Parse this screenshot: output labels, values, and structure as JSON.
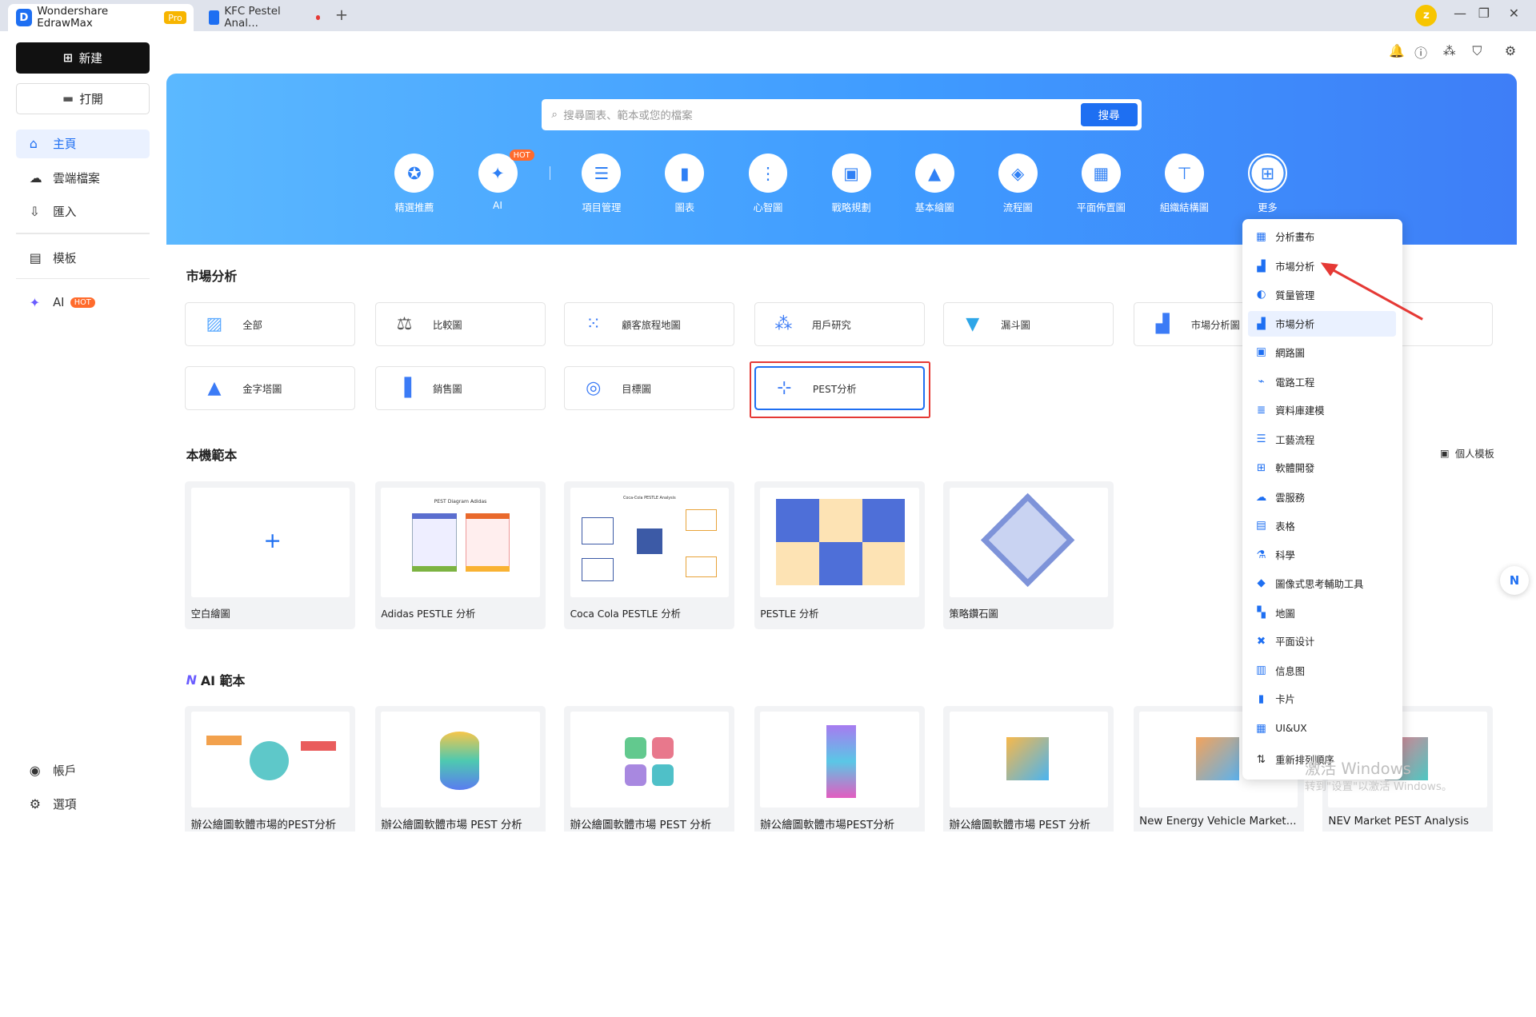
{
  "titlebar": {
    "app_title": "Wondershare EdrawMax",
    "pro_badge": "Pro",
    "doc_tab": "KFC Pestel Anal...",
    "avatar_letter": "z"
  },
  "sidebar": {
    "new_label": "新建",
    "open_label": "打開",
    "items": [
      {
        "label": "主頁",
        "icon": "home-icon"
      },
      {
        "label": "雲端檔案",
        "icon": "cloud-icon"
      },
      {
        "label": "匯入",
        "icon": "import-icon"
      },
      {
        "label": "模板",
        "icon": "template-icon"
      },
      {
        "label": "AI",
        "icon": "sparkle-icon",
        "badge": "HOT"
      }
    ],
    "bottom": [
      {
        "label": "帳戶",
        "icon": "account-icon"
      },
      {
        "label": "選項",
        "icon": "settings-icon"
      }
    ]
  },
  "search": {
    "placeholder": "搜尋圖表、範本或您的檔案",
    "button": "搜尋"
  },
  "categories": [
    {
      "label": "精選推薦",
      "icon": "recommend-icon"
    },
    {
      "label": "AI",
      "icon": "ai-icon",
      "badge": "HOT"
    },
    {
      "label": "項目管理",
      "icon": "project-icon"
    },
    {
      "label": "圖表",
      "icon": "chart-icon"
    },
    {
      "label": "心智圖",
      "icon": "mindmap-icon"
    },
    {
      "label": "戰略規劃",
      "icon": "strategy-icon"
    },
    {
      "label": "基本繪圖",
      "icon": "basic-icon"
    },
    {
      "label": "流程圖",
      "icon": "flowchart-icon"
    },
    {
      "label": "平面佈置圖",
      "icon": "floorplan-icon"
    },
    {
      "label": "組織結構圖",
      "icon": "org-icon"
    },
    {
      "label": "更多",
      "icon": "more-icon"
    }
  ],
  "market_section": {
    "title": "市場分析",
    "chips": [
      "全部",
      "比較圖",
      "顧客旅程地圖",
      "用戶研究",
      "漏斗圖",
      "市場分析圖",
      "金字塔圖",
      "銷售圖",
      "目標圖",
      "PEST分析"
    ]
  },
  "local_templates": {
    "title": "本機範本",
    "personal_label": "個人模板",
    "cards": [
      "空白繪圖",
      "Adidas PESTLE 分析",
      "Coca Cola PESTLE 分析",
      "PESTLE 分析",
      "策略鑽石圖"
    ],
    "adidas_thumb_title": "PEST Diagram Adidas",
    "coca_thumb_title": "Coca-Cola PESTLE Analysis"
  },
  "ai_templates": {
    "title": "AI 範本",
    "cards": [
      "辦公繪圖軟體市場的PEST分析",
      "辦公繪圖軟體市場 PEST 分析",
      "辦公繪圖軟體市場 PEST 分析",
      "辦公繪圖軟體市場PEST分析",
      "辦公繪圖軟體市場 PEST 分析",
      "New Energy Vehicle Market...",
      "NEV Market PEST Analysis"
    ]
  },
  "dropdown": {
    "items": [
      "分析畫布",
      "市場分析",
      "質量管理",
      "市場分析",
      "網路圖",
      "電路工程",
      "資料庫建模",
      "工藝流程",
      "軟體開發",
      "雲服務",
      "表格",
      "科學",
      "圖像式思考輔助工具",
      "地圖",
      "平面设计",
      "信息图",
      "卡片",
      "UI&UX",
      "重新排列順序"
    ]
  },
  "watermark": {
    "line1": "激活 Windows",
    "line2": "转到\"设置\"以激活 Windows。"
  },
  "colors": {
    "accent": "#1e6ff2",
    "hot": "#ff6b2c",
    "highlight_box": "#e53935"
  }
}
